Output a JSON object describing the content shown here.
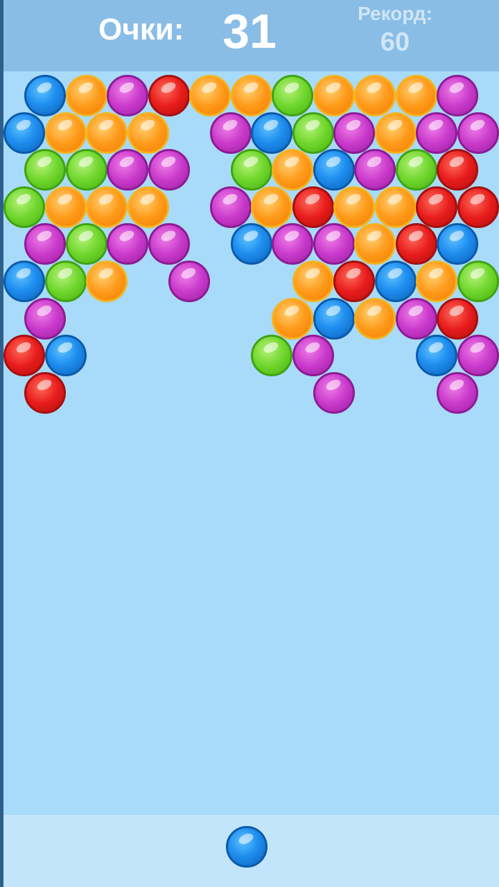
{
  "hud": {
    "score_label": "Очки:",
    "score_value": "31",
    "record_label": "Рекорд:",
    "record_value": "60"
  },
  "colors": {
    "blue": "#1f8ff0",
    "orange": "#ff9a1a",
    "purple": "#c93acb",
    "red": "#e81c1c",
    "green": "#6fd62c",
    "background": "#a7dbf9",
    "header": "#89bde6"
  },
  "grid": {
    "rows": [
      "BOPRQQGQQQP.",
      "BOOO.PBGPOPP",
      "GGPP.GOBPGR.",
      "GOOO.POROORR",
      "PGPP.BPPORB.",
      "BGO.P..ORBOG",
      "P.....OBOPR.",
      "RB....GP..BP",
      "R......P..P."
    ],
    "legend": {
      "B": "blue",
      "O": "orange",
      "P": "purple",
      "R": "red",
      "G": "green",
      "Q": "orange"
    }
  },
  "shooter": {
    "color": "blue"
  }
}
